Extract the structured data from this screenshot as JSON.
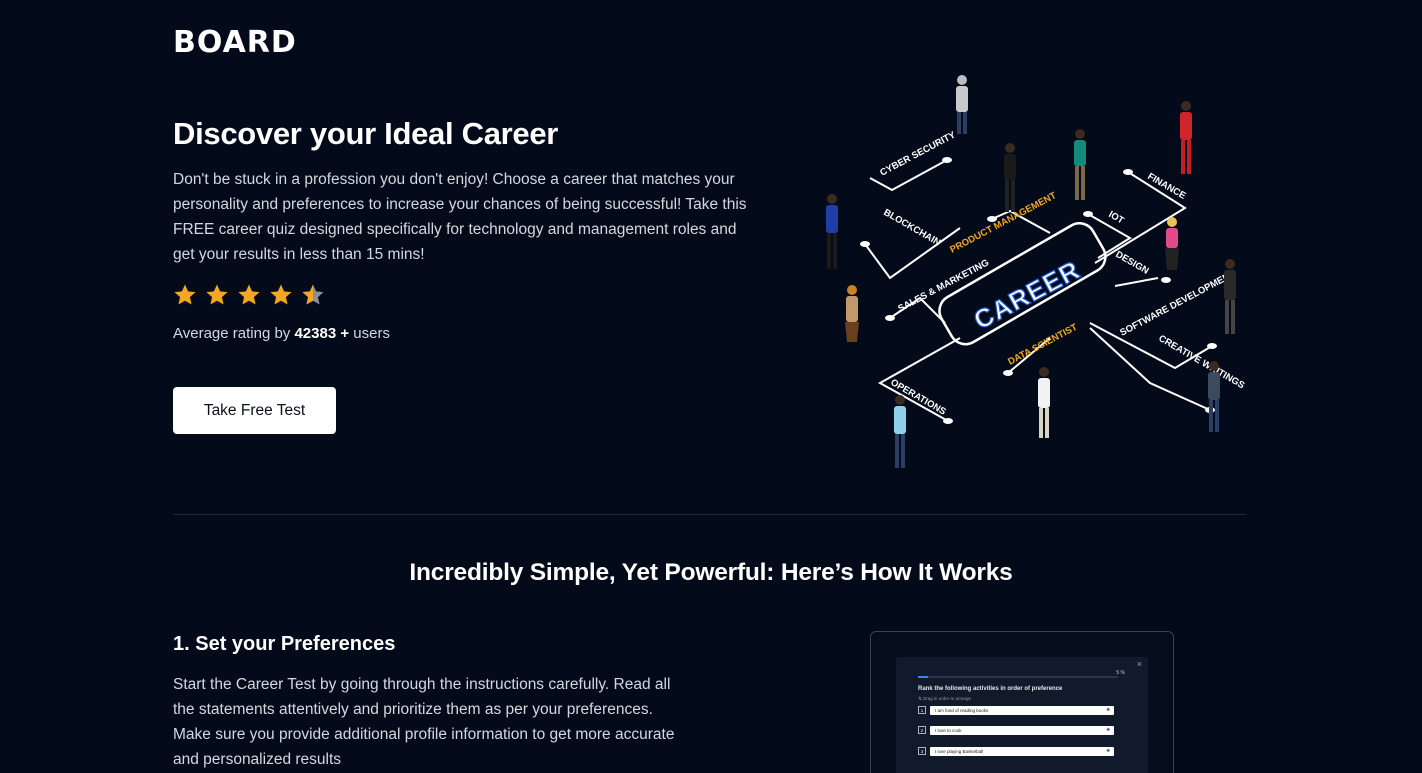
{
  "brand": {
    "logo_text": "BOARD"
  },
  "hero": {
    "title": "Discover your Ideal Career",
    "description": "Don't be stuck in a profession you don't enjoy! Choose a career that matches your personality and preferences to increase your chances of being successful! Take this FREE career quiz designed specifically for technology and management roles and get your results in less than 15 mins!",
    "rating": {
      "stars": 4.5,
      "max_stars": 5,
      "prefix": "Average rating by ",
      "count": "42383 +",
      "suffix": " users"
    },
    "cta_label": "Take Free Test",
    "star_color": "#f5a623"
  },
  "illustration": {
    "center_label": "CAREER",
    "branches": [
      "CYBER SECURITY",
      "BLOCKCHAIN",
      "PRODUCT MANAGEMENT",
      "IOT",
      "FINANCE",
      "DESIGN",
      "SALES & MARKETING",
      "SOFTWARE DEVELOPMENT",
      "CREATIVE WRITINGS",
      "DATA SCIENTIST",
      "OPERATIONS"
    ]
  },
  "how_it_works": {
    "title": "Incredibly Simple, Yet Powerful: Here’s How It Works",
    "step1": {
      "title": "1. Set your Preferences",
      "description": "Start the Career Test by going through the instructions carefully. Read all the statements attentively and prioritize them as per your preferences. Make sure you provide additional profile information to get more accurate and personalized results"
    },
    "preview": {
      "close": "×",
      "progress_text": "5 %",
      "progress": 0.05,
      "question": "Rank the following activities in order of preference",
      "hint": "Drag in order to arrange",
      "items": [
        {
          "num": "1",
          "text": "I am fond of reading books"
        },
        {
          "num": "2",
          "text": "I love to cook"
        },
        {
          "num": "3",
          "text": "I love playing Basketball"
        }
      ]
    }
  }
}
